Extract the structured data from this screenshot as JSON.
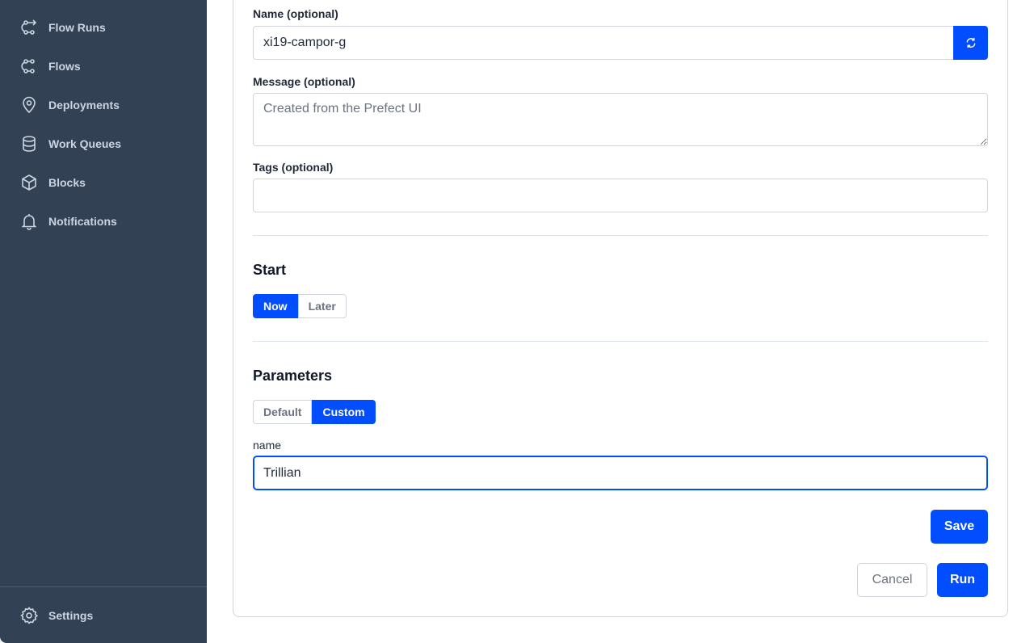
{
  "sidebar": {
    "items": [
      {
        "label": "Flow Runs",
        "icon": "flow-runs-icon"
      },
      {
        "label": "Flows",
        "icon": "flows-icon"
      },
      {
        "label": "Deployments",
        "icon": "map-pin-icon"
      },
      {
        "label": "Work Queues",
        "icon": "database-icon"
      },
      {
        "label": "Blocks",
        "icon": "cube-icon"
      },
      {
        "label": "Notifications",
        "icon": "bell-icon"
      }
    ],
    "settings": {
      "label": "Settings",
      "icon": "gear-icon"
    }
  },
  "form": {
    "name": {
      "label": "Name (optional)",
      "value": "xi19-campor-g"
    },
    "message": {
      "label": "Message (optional)",
      "placeholder": "Created from the Prefect UI",
      "value": ""
    },
    "tags": {
      "label": "Tags (optional)",
      "value": ""
    },
    "start": {
      "title": "Start",
      "options": [
        "Now",
        "Later"
      ],
      "selected": "Now"
    },
    "parameters": {
      "title": "Parameters",
      "options": [
        "Default",
        "Custom"
      ],
      "selected": "Custom",
      "fields": [
        {
          "label": "name",
          "value": "Trillian"
        }
      ]
    },
    "buttons": {
      "save": "Save",
      "cancel": "Cancel",
      "run": "Run"
    }
  },
  "colors": {
    "accent": "#024dfd",
    "sidebar_bg": "#334155"
  }
}
